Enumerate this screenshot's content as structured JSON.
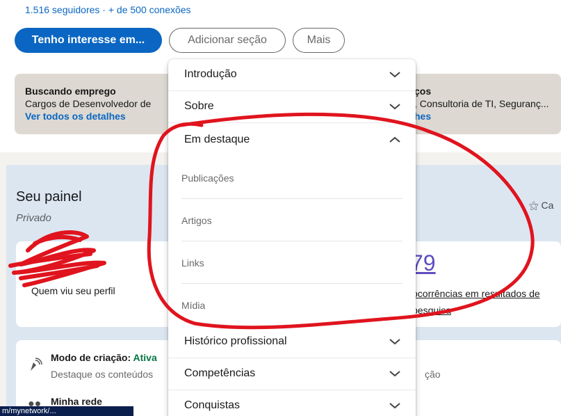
{
  "profile": {
    "followers_text": "1.516 seguidores · + de 500 conexões"
  },
  "actions": {
    "primary_label": "Tenho interesse em...",
    "add_section_label": "Adicionar seção",
    "more_label": "Mais"
  },
  "open_to_work": {
    "title": "Buscando emprego",
    "description": "Cargos de Desenvolvedor de",
    "link": "Ver todos os detalhes",
    "right_title": "ços",
    "right_description": ", Consultoria de TI, Seguranç...",
    "right_link": "hes"
  },
  "dashboard": {
    "title": "Seu painel",
    "visibility": "Privado",
    "right_label": "Ca",
    "stat_left_label": "Quem viu seu perfil",
    "stat_right_value": "79",
    "stat_right_label_line1": "ocorrências em resultados de",
    "stat_right_label_line2": "pesquisa"
  },
  "creator_mode": {
    "title": "Modo de criação:",
    "status": "Ativa",
    "description": "Destaque os conteúdos",
    "right_text": "ção",
    "network_label": "Minha rede"
  },
  "status_bar": {
    "url": "m/mynetwork/..."
  },
  "dropdown": {
    "sections": [
      {
        "label": "Introdução",
        "chevron": "chevron-down"
      },
      {
        "label": "Sobre",
        "chevron": "chevron-down"
      },
      {
        "label": "Em destaque",
        "chevron": "chevron-up"
      }
    ],
    "featured_items": [
      "Publicações",
      "Artigos",
      "Links",
      "Mídia"
    ],
    "lower_sections": [
      {
        "label": "Histórico profissional",
        "chevron": "chevron-down"
      },
      {
        "label": "Competências",
        "chevron": "chevron-down"
      },
      {
        "label": "Conquistas",
        "chevron": "chevron-down"
      }
    ]
  },
  "colors": {
    "brand_blue": "#0a66c2",
    "annotation_red": "#e0141e",
    "active_green": "#057642"
  }
}
